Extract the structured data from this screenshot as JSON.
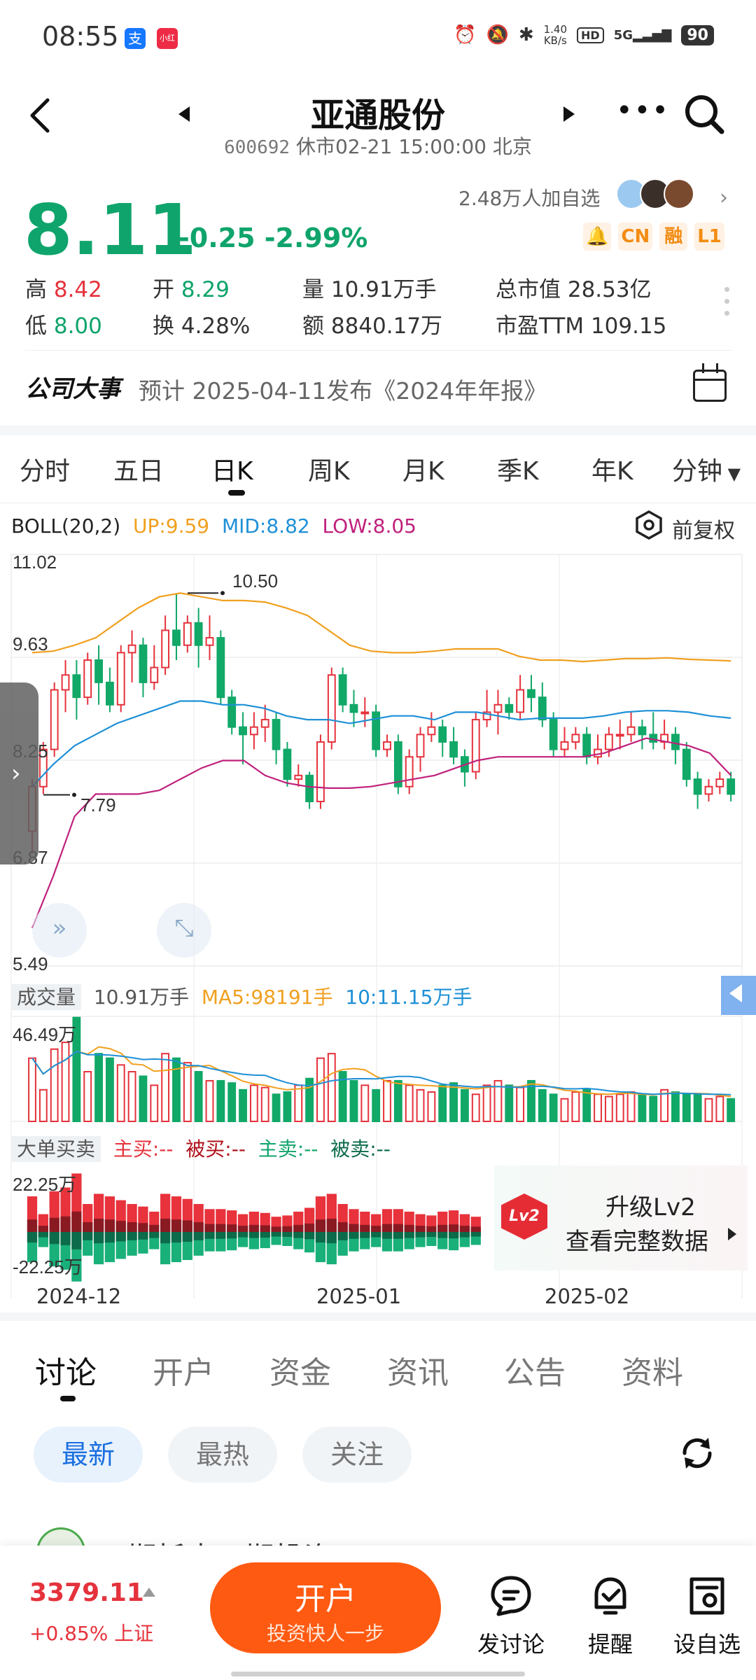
{
  "status_bar": {
    "time": "08:55",
    "app_badges": [
      "支",
      "小红书"
    ],
    "speed": "1.40\nKB/s",
    "hd": "HD",
    "network": "5G",
    "battery": "90"
  },
  "header": {
    "title": "亚通股份",
    "code": "600692",
    "status": "休市02-21 15:00:00 北京"
  },
  "quote": {
    "price": "8.11",
    "change": "-0.25",
    "change_pct": "-2.99%",
    "followers": "2.48万人加自选",
    "badges": [
      "CN",
      "融",
      "L1"
    ],
    "high_label": "高",
    "high": "8.42",
    "low_label": "低",
    "low": "8.00",
    "open_label": "开",
    "open": "8.29",
    "turnover_label": "换",
    "turnover": "4.28%",
    "volume_label": "量",
    "volume": "10.91万手",
    "amount_label": "额",
    "amount": "8840.17万",
    "mktcap_label": "总市值",
    "mktcap": "28.53亿",
    "pe_label": "市盈TTM",
    "pe": "109.15"
  },
  "event": {
    "label": "公司大事",
    "text": "预计 2025-04-11发布《2024年年报》"
  },
  "period_tabs": [
    "分时",
    "五日",
    "日K",
    "周K",
    "月K",
    "季K",
    "年K",
    "分钟"
  ],
  "period_active": "日K",
  "boll": {
    "name": "BOLL(20,2)",
    "up": "UP:9.59",
    "mid": "MID:8.82",
    "low": "LOW:8.05",
    "adjust": "前复权",
    "up_color": "#f0a020",
    "mid_color": "#1e90d6",
    "low_color": "#c0217c"
  },
  "chart_labels": {
    "y_max": "11.02",
    "y_upper": "9.63",
    "y_mid": "8.25",
    "y_lower": "6.87",
    "y_min": "5.49",
    "high_marker": "10.50",
    "low_marker": "7.79",
    "x_labels": [
      "2024-12",
      "2025-01",
      "2025-02"
    ]
  },
  "volume": {
    "tag": "成交量",
    "value": "10.91万手",
    "ma5": "MA5:98191手",
    "ma10": "10:11.15万手",
    "y_max": "46.49万"
  },
  "big_orders": {
    "tag": "大单买卖",
    "main_buy": "主买:--",
    "passive_buy": "被买:--",
    "main_sell": "主卖:--",
    "passive_sell": "被卖:--",
    "y_max": "22.25万",
    "y_min": "-22.25万"
  },
  "lv2": {
    "badge": "Lv2",
    "line1": "升级Lv2",
    "line2": "查看完整数据"
  },
  "bottom_tabs": [
    "讨论",
    "开户",
    "资金",
    "资讯",
    "公告",
    "资料"
  ],
  "chips": [
    "最新",
    "最热",
    "关注"
  ],
  "post_preview": "二期托克二期投资",
  "footer": {
    "index_value": "3379.11",
    "index_change": "+0.85% 上证",
    "open_account": "开户",
    "open_sub": "投资快人一步",
    "actions": [
      "发讨论",
      "提醒",
      "设自选"
    ]
  },
  "chart_data": {
    "type": "candlestick",
    "title": "",
    "ylim": [
      5.49,
      11.02
    ],
    "x_labels": [
      "2024-12",
      "2025-01",
      "2025-02"
    ],
    "candles": [
      [
        7.3,
        7.9,
        7.0,
        8.0
      ],
      [
        7.9,
        8.4,
        7.8,
        8.5
      ],
      [
        8.4,
        9.2,
        8.3,
        9.3
      ],
      [
        9.2,
        9.4,
        8.9,
        9.6
      ],
      [
        9.4,
        9.1,
        8.8,
        9.6
      ],
      [
        9.1,
        9.6,
        9.0,
        9.7
      ],
      [
        9.6,
        9.3,
        9.0,
        9.8
      ],
      [
        9.3,
        9.0,
        8.9,
        9.5
      ],
      [
        9.0,
        9.7,
        8.9,
        9.8
      ],
      [
        9.7,
        9.8,
        9.3,
        10.0
      ],
      [
        9.8,
        9.3,
        9.1,
        9.9
      ],
      [
        9.3,
        9.5,
        9.2,
        9.8
      ],
      [
        9.5,
        10.0,
        9.4,
        10.2
      ],
      [
        10.0,
        9.8,
        9.6,
        10.5
      ],
      [
        9.8,
        10.1,
        9.7,
        10.2
      ],
      [
        10.1,
        9.8,
        9.5,
        10.3
      ],
      [
        9.8,
        9.9,
        9.6,
        10.2
      ],
      [
        9.9,
        9.1,
        9.0,
        10.0
      ],
      [
        9.1,
        8.7,
        8.6,
        9.2
      ],
      [
        8.7,
        8.6,
        8.2,
        8.9
      ],
      [
        8.6,
        8.7,
        8.4,
        8.9
      ],
      [
        8.7,
        8.8,
        8.5,
        9.0
      ],
      [
        8.8,
        8.4,
        8.2,
        8.9
      ],
      [
        8.4,
        8.0,
        7.9,
        8.5
      ],
      [
        8.0,
        8.05,
        7.9,
        8.2
      ],
      [
        8.05,
        7.7,
        7.6,
        8.1
      ],
      [
        7.7,
        8.5,
        7.6,
        8.6
      ],
      [
        8.5,
        9.4,
        8.4,
        9.5
      ],
      [
        9.4,
        9.0,
        8.9,
        9.5
      ],
      [
        9.0,
        8.9,
        8.7,
        9.2
      ],
      [
        8.9,
        8.9,
        8.7,
        9.1
      ],
      [
        8.9,
        8.4,
        8.3,
        9.0
      ],
      [
        8.4,
        8.5,
        8.3,
        8.6
      ],
      [
        8.5,
        7.9,
        7.8,
        8.6
      ],
      [
        7.9,
        8.3,
        7.8,
        8.4
      ],
      [
        8.3,
        8.6,
        8.1,
        8.7
      ],
      [
        8.6,
        8.7,
        8.5,
        8.9
      ],
      [
        8.7,
        8.5,
        8.3,
        8.8
      ],
      [
        8.5,
        8.3,
        8.2,
        8.7
      ],
      [
        8.3,
        8.1,
        7.9,
        8.4
      ],
      [
        8.1,
        8.8,
        8.0,
        8.9
      ],
      [
        8.8,
        8.9,
        8.7,
        9.2
      ],
      [
        8.9,
        9.0,
        8.6,
        9.2
      ],
      [
        9.0,
        8.9,
        8.8,
        9.1
      ],
      [
        8.9,
        9.2,
        8.8,
        9.4
      ],
      [
        9.2,
        9.1,
        8.9,
        9.4
      ],
      [
        9.1,
        8.8,
        8.7,
        9.3
      ],
      [
        8.8,
        8.4,
        8.3,
        8.9
      ],
      [
        8.4,
        8.5,
        8.3,
        8.7
      ],
      [
        8.5,
        8.6,
        8.4,
        8.7
      ],
      [
        8.6,
        8.3,
        8.2,
        8.7
      ],
      [
        8.3,
        8.4,
        8.2,
        8.6
      ],
      [
        8.4,
        8.6,
        8.3,
        8.7
      ],
      [
        8.6,
        8.6,
        8.4,
        8.8
      ],
      [
        8.6,
        8.7,
        8.5,
        8.9
      ],
      [
        8.7,
        8.6,
        8.4,
        8.8
      ],
      [
        8.6,
        8.5,
        8.4,
        8.9
      ],
      [
        8.5,
        8.6,
        8.4,
        8.8
      ],
      [
        8.6,
        8.4,
        8.2,
        8.7
      ],
      [
        8.4,
        8.0,
        7.9,
        8.5
      ],
      [
        8.0,
        7.8,
        7.6,
        8.1
      ],
      [
        7.8,
        7.9,
        7.7,
        8.0
      ],
      [
        7.9,
        8.0,
        7.8,
        8.1
      ],
      [
        8.0,
        7.8,
        7.7,
        8.1
      ]
    ],
    "boll_up": [
      9.7,
      9.72,
      9.8,
      9.9,
      10.1,
      10.3,
      10.45,
      10.5,
      10.45,
      10.4,
      10.4,
      10.38,
      10.3,
      10.2,
      10.0,
      9.8,
      9.72,
      9.7,
      9.7,
      9.72,
      9.75,
      9.75,
      9.75,
      9.65,
      9.6,
      9.6,
      9.58,
      9.6,
      9.62,
      9.62,
      9.63,
      9.61,
      9.6,
      9.59
    ],
    "boll_mid": [
      7.9,
      8.2,
      8.45,
      8.6,
      8.75,
      8.85,
      8.95,
      9.05,
      9.05,
      9.0,
      9.0,
      8.95,
      8.85,
      8.8,
      8.8,
      8.75,
      8.8,
      8.85,
      8.85,
      8.8,
      8.9,
      8.9,
      8.85,
      8.8,
      8.82,
      8.82,
      8.82,
      8.85,
      8.9,
      8.92,
      8.92,
      8.9,
      8.85,
      8.82
    ],
    "boll_low": [
      6.0,
      6.7,
      7.5,
      7.8,
      7.8,
      7.8,
      7.85,
      8.0,
      8.15,
      8.25,
      8.25,
      8.05,
      7.95,
      7.9,
      7.88,
      7.88,
      7.9,
      7.95,
      8.0,
      8.05,
      8.15,
      8.25,
      8.3,
      8.3,
      8.3,
      8.3,
      8.3,
      8.35,
      8.45,
      8.55,
      8.5,
      8.45,
      8.35,
      8.05
    ],
    "volume_ylim": [
      0,
      46.49
    ],
    "volume": [
      28,
      14,
      32,
      35,
      46,
      22,
      30,
      28,
      25,
      22,
      20,
      16,
      30,
      28,
      26,
      22,
      18,
      18,
      17,
      14,
      16,
      15,
      12,
      13,
      16,
      19,
      28,
      30,
      22,
      18,
      16,
      14,
      18,
      18,
      16,
      14,
      13,
      16,
      17,
      14,
      12,
      16,
      18,
      16,
      15,
      18,
      14,
      12,
      10,
      13,
      14,
      12,
      11,
      12,
      13,
      12,
      11,
      14,
      13,
      12,
      12,
      10,
      11,
      10
    ],
    "big_orders_ylim": [
      -22.25,
      22.25
    ]
  }
}
